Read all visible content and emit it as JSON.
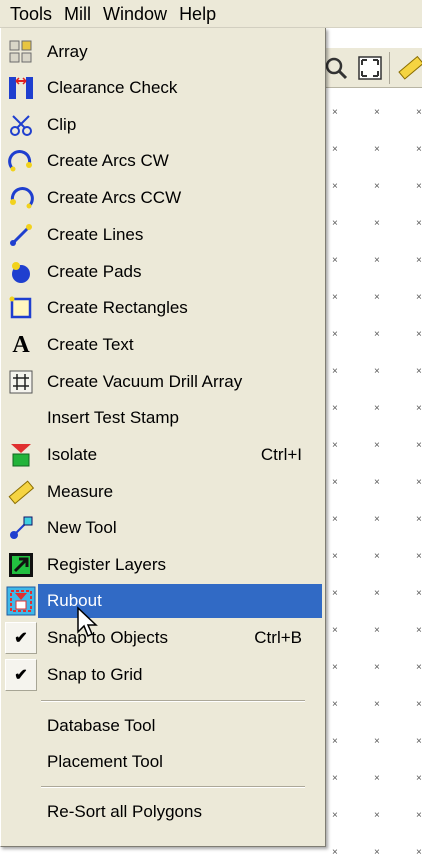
{
  "menubar": {
    "items": [
      {
        "label": "Tools"
      },
      {
        "label": "Mill"
      },
      {
        "label": "Window"
      },
      {
        "label": "Help"
      }
    ]
  },
  "menu": {
    "items": [
      {
        "label": "Array",
        "icon": "array-icon",
        "shortcut": ""
      },
      {
        "label": "Clearance Check",
        "icon": "clearance-check-icon",
        "shortcut": ""
      },
      {
        "label": "Clip",
        "icon": "clip-icon",
        "shortcut": ""
      },
      {
        "label": "Create Arcs CW",
        "icon": "arc-cw-icon",
        "shortcut": ""
      },
      {
        "label": "Create Arcs CCW",
        "icon": "arc-ccw-icon",
        "shortcut": ""
      },
      {
        "label": "Create Lines",
        "icon": "lines-icon",
        "shortcut": ""
      },
      {
        "label": "Create Pads",
        "icon": "pads-icon",
        "shortcut": ""
      },
      {
        "label": "Create Rectangles",
        "icon": "rectangle-icon",
        "shortcut": ""
      },
      {
        "label": "Create Text",
        "icon": "text-icon",
        "shortcut": ""
      },
      {
        "label": "Create Vacuum Drill Array",
        "icon": "drill-array-icon",
        "shortcut": ""
      },
      {
        "label": "Insert Test Stamp",
        "icon": "",
        "shortcut": ""
      },
      {
        "label": "Isolate",
        "icon": "isolate-icon",
        "shortcut": "Ctrl+I"
      },
      {
        "label": "Measure",
        "icon": "measure-icon",
        "shortcut": ""
      },
      {
        "label": "New Tool",
        "icon": "new-tool-icon",
        "shortcut": ""
      },
      {
        "label": "Register Layers",
        "icon": "register-layers-icon",
        "shortcut": ""
      },
      {
        "label": "Rubout",
        "icon": "rubout-icon",
        "shortcut": "",
        "highlighted": true
      },
      {
        "label": "Snap to Objects",
        "icon": "check-icon",
        "shortcut": "Ctrl+B",
        "checked": true
      },
      {
        "label": "Snap to Grid",
        "icon": "check-icon",
        "shortcut": "",
        "checked": true
      },
      {
        "label": "Database Tool",
        "icon": "",
        "shortcut": ""
      },
      {
        "label": "Placement Tool",
        "icon": "",
        "shortcut": ""
      },
      {
        "label": "Re-Sort all Polygons",
        "icon": "",
        "shortcut": ""
      }
    ],
    "highlight_color": "#316ac5",
    "background_color": "#ece9d8"
  },
  "toolbar": {
    "icons": [
      "zoom-icon",
      "fit-view-icon",
      "measure-icon"
    ]
  }
}
